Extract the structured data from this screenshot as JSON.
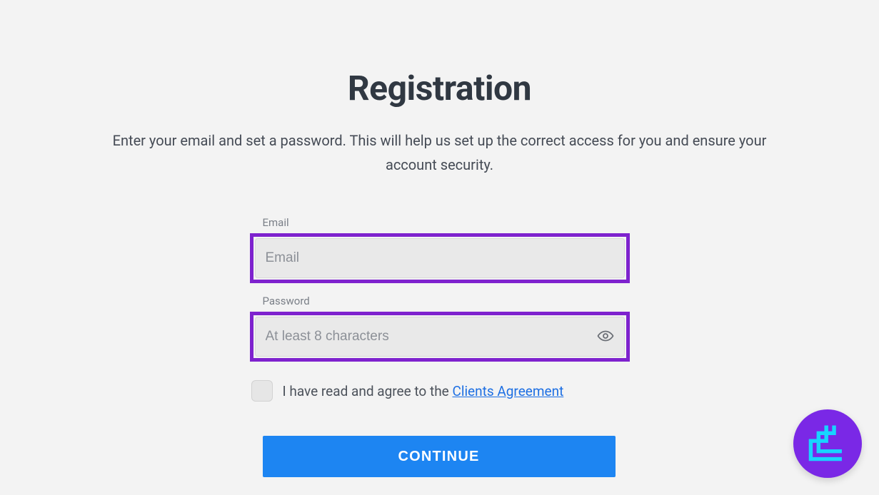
{
  "page": {
    "title": "Registration",
    "subtitle": "Enter your email and set a password. This will help us set up the correct access for you and ensure your account security."
  },
  "form": {
    "email": {
      "label": "Email",
      "placeholder": "Email",
      "value": ""
    },
    "password": {
      "label": "Password",
      "placeholder": "At least 8 characters",
      "value": ""
    },
    "agreement": {
      "prefix": "I have read and agree to the ",
      "link_text": "Clients Agreement",
      "checked": false
    },
    "continue_label": "CONTINUE"
  },
  "colors": {
    "highlight_border": "#7e22ce",
    "primary_button": "#1d85f2",
    "fab_bg": "#7a28e6",
    "fab_icon": "#17d4ff"
  }
}
